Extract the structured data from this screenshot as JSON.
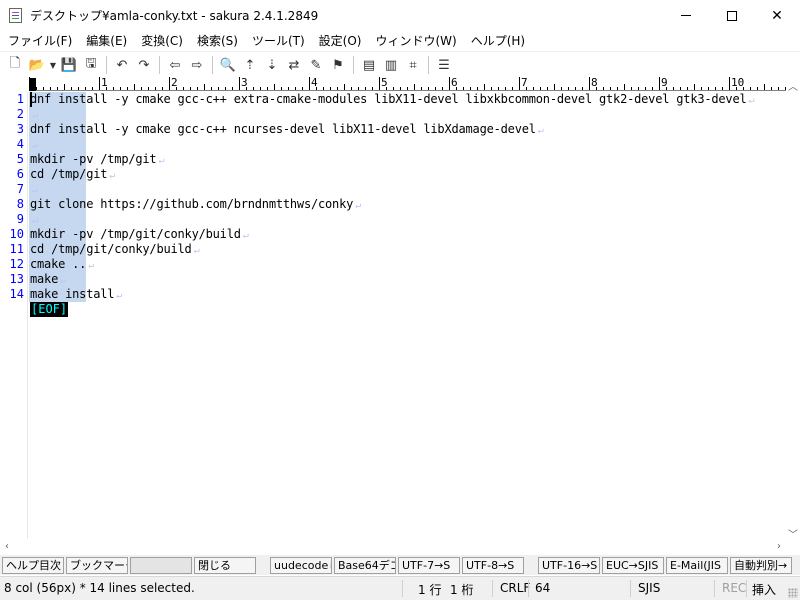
{
  "window": {
    "title": "デスクトップ¥amla-conky.txt - sakura 2.4.1.2849",
    "minimize_icon": "minimize-icon",
    "maximize_icon": "maximize-icon",
    "close_glyph": "✕"
  },
  "menu": [
    {
      "label": "ファイル(F)"
    },
    {
      "label": "編集(E)"
    },
    {
      "label": "変換(C)"
    },
    {
      "label": "検索(S)"
    },
    {
      "label": "ツール(T)"
    },
    {
      "label": "設定(O)"
    },
    {
      "label": "ウィンドウ(W)"
    },
    {
      "label": "ヘルプ(H)"
    }
  ],
  "toolbar": {
    "icons": [
      {
        "name": "new-file-icon",
        "glyph": "🗋"
      },
      {
        "name": "open-folder-icon",
        "glyph": "📂"
      },
      {
        "name": "save-icon",
        "glyph": "💾"
      },
      {
        "name": "save-all-icon",
        "glyph": "🖫"
      },
      {
        "name": "undo-icon",
        "glyph": "↶"
      },
      {
        "name": "redo-icon",
        "glyph": "↷"
      },
      {
        "name": "jump-back-icon",
        "glyph": "⇦"
      },
      {
        "name": "jump-forward-icon",
        "glyph": "⇨"
      },
      {
        "name": "search-icon",
        "glyph": "🔍"
      },
      {
        "name": "search-up-icon",
        "glyph": "⇡"
      },
      {
        "name": "search-down-icon",
        "glyph": "⇣"
      },
      {
        "name": "replace-icon",
        "glyph": "⇄"
      },
      {
        "name": "mark-clear-icon",
        "glyph": "✎"
      },
      {
        "name": "bookmark-icon",
        "glyph": "⚑"
      },
      {
        "name": "grep-icon",
        "glyph": "▤"
      },
      {
        "name": "compare-icon",
        "glyph": "▥"
      },
      {
        "name": "outline-icon",
        "glyph": "⌗"
      },
      {
        "name": "settings-icon",
        "glyph": "☰"
      }
    ]
  },
  "ruler": {
    "numbers": [
      "1",
      "2",
      "3",
      "4",
      "5",
      "6",
      "7",
      "8",
      "9",
      "10"
    ]
  },
  "editor": {
    "lines": [
      {
        "no": "1",
        "text": "dnf install -y cmake gcc-c++ extra-cmake-modules libX11-devel libxkbcommon-devel gtk2-devel gtk3-devel"
      },
      {
        "no": "2",
        "text": ""
      },
      {
        "no": "3",
        "text": "dnf install -y cmake gcc-c++ ncurses-devel libX11-devel libXdamage-devel"
      },
      {
        "no": "4",
        "text": ""
      },
      {
        "no": "5",
        "text": "mkdir -pv /tmp/git"
      },
      {
        "no": "6",
        "text": "cd /tmp/git"
      },
      {
        "no": "7",
        "text": ""
      },
      {
        "no": "8",
        "text": "git clone https://github.com/brndnmtthws/conky"
      },
      {
        "no": "9",
        "text": ""
      },
      {
        "no": "10",
        "text": "mkdir -pv /tmp/git/conky/build"
      },
      {
        "no": "11",
        "text": "cd /tmp/git/conky/build"
      },
      {
        "no": "12",
        "text": "cmake .."
      },
      {
        "no": "13",
        "text": "make"
      },
      {
        "no": "14",
        "text": "make install"
      }
    ],
    "eol_mark": "↵",
    "eof_mark": "[EOF]"
  },
  "fkeys": [
    {
      "label": "ヘルプ目次"
    },
    {
      "label": "ブックマーク"
    },
    {
      "label": ""
    },
    {
      "label": "閉じる"
    },
    {
      "label": "uudecodeし"
    },
    {
      "label": "Base64デコ"
    },
    {
      "label": "UTF-7→S"
    },
    {
      "label": "UTF-8→S"
    },
    {
      "label": "UTF-16→S"
    },
    {
      "label": "EUC→SJIS"
    },
    {
      "label": "E-Mail(JIS"
    },
    {
      "label": "自動判別→"
    }
  ],
  "status": {
    "selection": "8 col (56px) * 14 lines selected.",
    "row": "1 行",
    "col": "1 桁",
    "eol": "CRLF",
    "char_code": "64",
    "encoding": "SJIS",
    "rec": "REC",
    "mode": "挿入"
  },
  "colors": {
    "line_number": "#0000ff",
    "selection": "#c6d8f0",
    "eof_bg": "#000000",
    "eof_fg": "#00ffff"
  }
}
